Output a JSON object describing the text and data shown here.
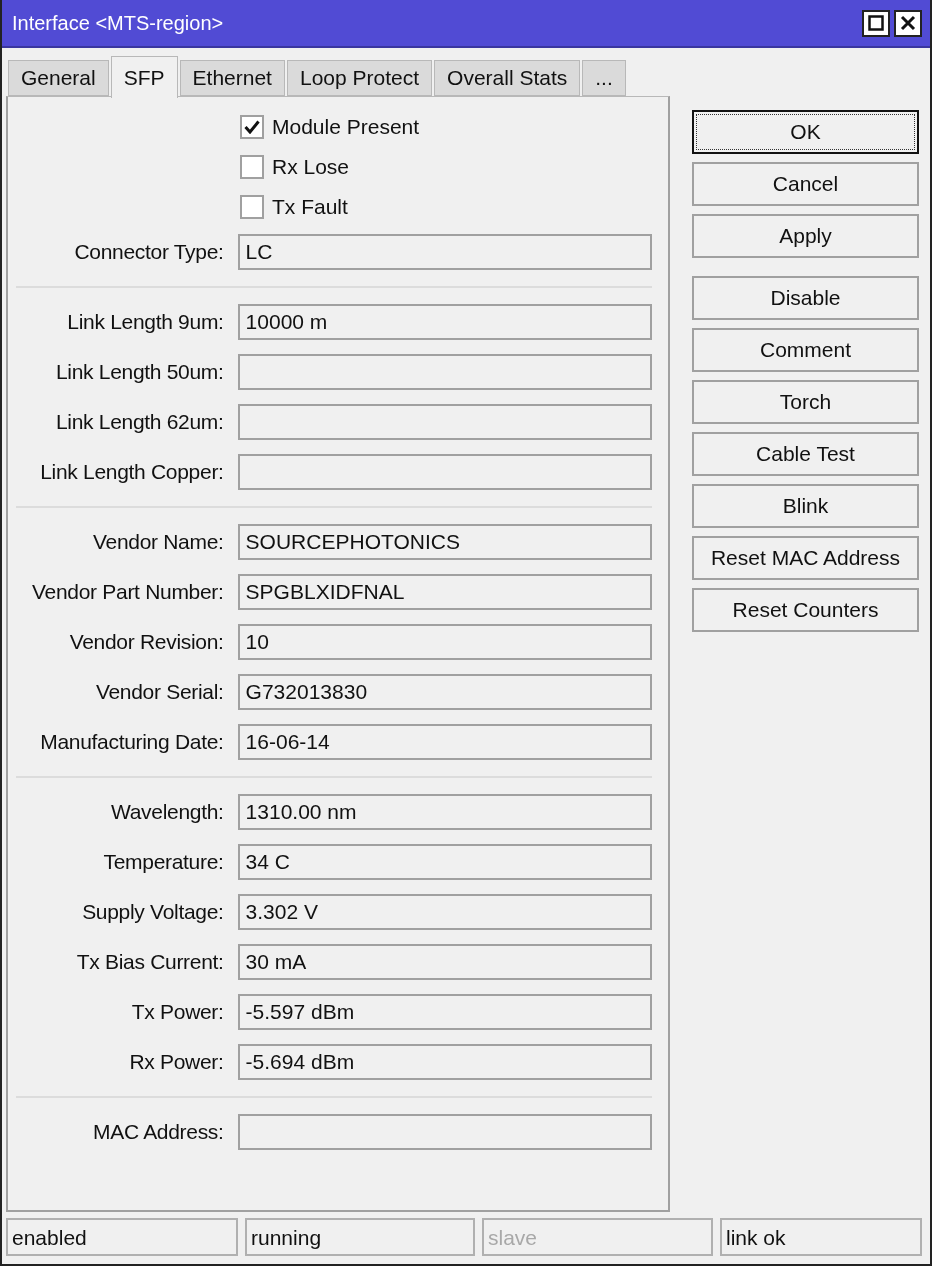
{
  "window": {
    "title": "Interface <MTS-region>"
  },
  "tabs": [
    {
      "label": "General",
      "selected": false
    },
    {
      "label": "SFP",
      "selected": true
    },
    {
      "label": "Ethernet",
      "selected": false
    },
    {
      "label": "Loop Protect",
      "selected": false
    },
    {
      "label": "Overall Stats",
      "selected": false
    },
    {
      "label": "...",
      "selected": false
    }
  ],
  "checkboxes": [
    {
      "label": "Module Present",
      "checked": true
    },
    {
      "label": "Rx Lose",
      "checked": false
    },
    {
      "label": "Tx Fault",
      "checked": false
    }
  ],
  "sections": [
    [
      {
        "label": "Connector Type:",
        "value": "LC"
      }
    ],
    [
      {
        "label": "Link Length 9um:",
        "value": "10000 m"
      },
      {
        "label": "Link Length 50um:"
      },
      {
        "label": "Link Length 62um:"
      },
      {
        "label": "Link Length Copper:"
      }
    ],
    [
      {
        "label": "Vendor Name:",
        "value": "SOURCEPHOTONICS"
      },
      {
        "label": "Vendor Part Number:",
        "value": "SPGBLXIDFNAL"
      },
      {
        "label": "Vendor Revision:",
        "value": "10"
      },
      {
        "label": "Vendor Serial:",
        "value": "G732013830"
      },
      {
        "label": "Manufacturing Date:",
        "value": "16-06-14"
      }
    ],
    [
      {
        "label": "Wavelength:",
        "value": "1310.00 nm"
      },
      {
        "label": "Temperature:",
        "value": "34 C"
      },
      {
        "label": "Supply Voltage:",
        "value": "3.302 V"
      },
      {
        "label": "Tx Bias Current:",
        "value": "30 mA"
      },
      {
        "label": "Tx Power:",
        "value": "-5.597 dBm"
      },
      {
        "label": "Rx Power:",
        "value": "-5.694 dBm"
      }
    ],
    [
      {
        "label": "MAC Address:"
      }
    ]
  ],
  "buttons": [
    [
      {
        "label": "OK",
        "default": true
      },
      {
        "label": "Cancel",
        "default": false
      },
      {
        "label": "Apply",
        "default": false
      }
    ],
    [
      {
        "label": "Disable",
        "default": false
      },
      {
        "label": "Comment",
        "default": false
      },
      {
        "label": "Torch",
        "default": false
      },
      {
        "label": "Cable Test",
        "default": false
      },
      {
        "label": "Blink",
        "default": false
      },
      {
        "label": "Reset MAC Address",
        "default": false
      },
      {
        "label": "Reset Counters",
        "default": false
      }
    ]
  ],
  "status_bar": [
    {
      "text": "enabled",
      "disabled": false
    },
    {
      "text": "running",
      "disabled": false
    },
    {
      "text": "slave",
      "disabled": true
    },
    {
      "text": "link ok",
      "disabled": false
    }
  ]
}
